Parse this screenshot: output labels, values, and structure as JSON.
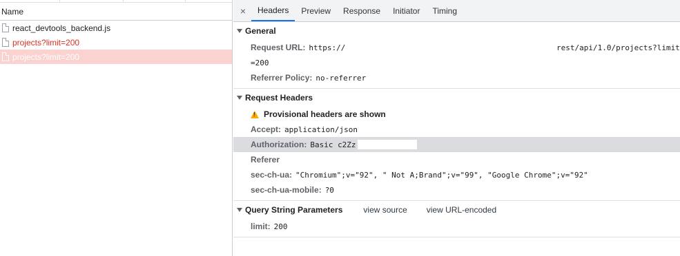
{
  "requests": {
    "column_header": "Name",
    "items": [
      {
        "name": "react_devtools_backend.js",
        "status": "ok"
      },
      {
        "name": "projects?limit=200",
        "status": "error"
      },
      {
        "name": "projects?limit=200",
        "status": "selected"
      }
    ]
  },
  "details": {
    "close_glyph": "×",
    "tabs": [
      "Headers",
      "Preview",
      "Response",
      "Initiator",
      "Timing"
    ],
    "active_tab": "Headers",
    "general": {
      "title": "General",
      "request_url_label": "Request URL:",
      "request_url_start": "https://",
      "request_url_end": "rest/api/1.0/projects?limit",
      "request_url_wrap": "=200",
      "referrer_policy_label": "Referrer Policy:",
      "referrer_policy_value": "no-referrer"
    },
    "request_headers": {
      "title": "Request Headers",
      "provisional_warning": "Provisional headers are shown",
      "headers": [
        {
          "key": "Accept:",
          "value": "application/json"
        },
        {
          "key": "Authorization:",
          "value": "Basic c2Zz"
        },
        {
          "key": "Referer",
          "value": ""
        },
        {
          "key": "sec-ch-ua:",
          "value": "\"Chromium\";v=\"92\", \" Not A;Brand\";v=\"99\", \"Google Chrome\";v=\"92\""
        },
        {
          "key": "sec-ch-ua-mobile:",
          "value": "?0"
        }
      ]
    },
    "query_string": {
      "title": "Query String Parameters",
      "view_source": "view source",
      "view_url_encoded": "view URL-encoded",
      "params": [
        {
          "key": "limit:",
          "value": "200"
        }
      ]
    }
  },
  "colors": {
    "error_text": "#d93025",
    "selected_row": "#fad2cf",
    "active_tab_underline": "#1a73e8",
    "warning_icon": "#f9ab00"
  }
}
